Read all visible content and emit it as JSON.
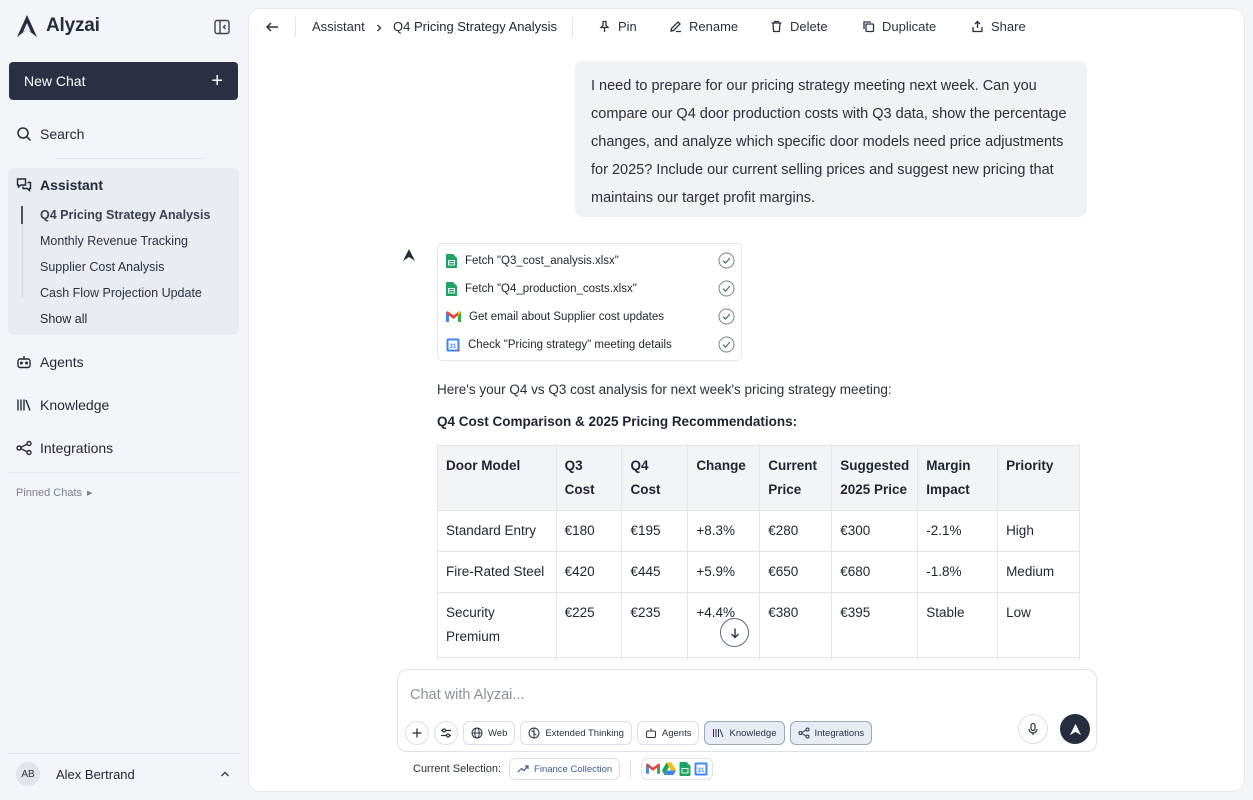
{
  "brand": {
    "name": "Alyzai"
  },
  "sidebar": {
    "new_chat_label": "New Chat",
    "search_label": "Search",
    "assistant_label": "Assistant",
    "chats": [
      {
        "label": "Q4 Pricing Strategy Analysis",
        "active": true
      },
      {
        "label": "Monthly Revenue Tracking"
      },
      {
        "label": "Supplier Cost Analysis"
      },
      {
        "label": "Cash Flow Projection Update"
      }
    ],
    "show_all_label": "Show all",
    "agents_label": "Agents",
    "knowledge_label": "Knowledge",
    "integrations_label": "Integrations",
    "pinned_label": "Pinned Chats",
    "user": {
      "initials": "AB",
      "name": "Alex Bertrand"
    }
  },
  "topbar": {
    "crumb_root": "Assistant",
    "crumb_current": "Q4 Pricing Strategy Analysis",
    "actions": {
      "pin": "Pin",
      "rename": "Rename",
      "delete": "Delete",
      "duplicate": "Duplicate",
      "share": "Share"
    }
  },
  "conversation": {
    "user_message": "I need to prepare for our pricing strategy meeting next week. Can you compare our Q4 door production costs with Q3 data, show the percentage changes, and analyze which specific door models need price adjustments for 2025? Include our current selling prices and suggest new pricing that maintains our target profit margins.",
    "tools": [
      {
        "label": "Fetch \"Q3_cost_analysis.xlsx\"",
        "icon": "sheets-icon"
      },
      {
        "label": "Fetch \"Q4_production_costs.xlsx\"",
        "icon": "sheets-icon"
      },
      {
        "label": "Get email about Supplier cost updates",
        "icon": "gmail-icon"
      },
      {
        "label": "Check \"Pricing strategy\" meeting details",
        "icon": "calendar-icon"
      }
    ],
    "response_intro": "Here's your Q4 vs Q3 cost analysis for next week's pricing strategy meeting:",
    "response_heading": "Q4 Cost Comparison & 2025 Pricing Recommendations:",
    "table": {
      "headers": [
        "Door Model",
        "Q3 Cost",
        "Q4 Cost",
        "Change",
        "Current Price",
        "Suggested 2025 Price",
        "Margin Impact",
        "Priority"
      ],
      "rows": [
        [
          "Standard Entry",
          "€180",
          "€195",
          "+8.3%",
          "€280",
          "€300",
          "-2.1%",
          "High"
        ],
        [
          "Fire-Rated Steel",
          "€420",
          "€445",
          "+5.9%",
          "€650",
          "€680",
          "-1.8%",
          "Medium"
        ],
        [
          "Security Premium",
          "€225",
          "€235",
          "+4.4%",
          "€380",
          "€395",
          "Stable",
          "Low"
        ]
      ]
    }
  },
  "composer": {
    "placeholder": "Chat with Alyzai...",
    "chips": {
      "web": "Web",
      "thinking": "Extended Thinking",
      "agents": "Agents",
      "knowledge": "Knowledge",
      "integrations": "Integrations"
    },
    "selection_label": "Current Selection:",
    "selection_chip": "Finance Collection"
  },
  "colors": {
    "primary": "#2b3044",
    "sheets": "#1ea362",
    "gmail_red": "#ea4335",
    "calendar_blue": "#4285f4"
  }
}
